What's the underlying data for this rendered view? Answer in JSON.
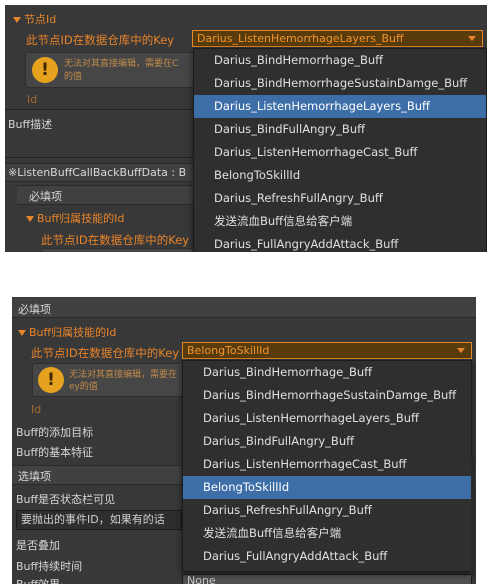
{
  "top": {
    "section_header": "节点Id",
    "key_label": "此节点ID在数据仓库中的Key",
    "selected_value": "Darius_ListenHemorrhageLayers_Buff",
    "help_text_line1": "无法对其直接编辑，需要在C",
    "help_text_line2": "的值",
    "id_label": "Id",
    "buff_desc_label": "Buff描述",
    "buffdata_header": "※ListenBuffCallBackBuffData : B",
    "required_label": "必填项",
    "skill_id_header": "Buff归属技能的Id",
    "key_label2": "此节点ID在数据仓库中的Key"
  },
  "bottom": {
    "required_label": "必填项",
    "skill_id_header": "Buff归属技能的Id",
    "key_label": "此节点ID在数据仓库中的Key",
    "selected_value": "BelongToSkillId",
    "help_text_line1": "无法对其直接编辑，需要在",
    "help_text_line2": "ey的值",
    "id_label": "Id",
    "add_target_label": "Buff的添加目标",
    "basic_feature_label": "Buff的基本特征",
    "optional_label": "选填项",
    "status_bar_label": "Buff是否状态栏可见",
    "event_id_value": "要抛出的事件ID，如果有的话",
    "stackable_label": "是否叠加",
    "duration_label": "Buff持续时间",
    "partial_label": "Buff效果·",
    "none_value": "None"
  },
  "dropdown_options": [
    "Darius_BindHemorrhage_Buff",
    "Darius_BindHemorrhageSustainDamge_Buff",
    "Darius_ListenHemorrhageLayers_Buff",
    "Darius_BindFullAngry_Buff",
    "Darius_ListenHemorrhageCast_Buff",
    "BelongToSkillId",
    "Darius_RefreshFullAngry_Buff",
    "发送流血Buff信息给客户端",
    "Darius_FullAngryAddAttack_Buff"
  ],
  "colors": {
    "panel_bg": "#383838",
    "accent_orange": "#e8842a",
    "selection_blue": "#3d6ea8",
    "warning_yellow": "#e6a11f"
  },
  "icons": {
    "warning": "warning-icon",
    "foldout": "foldout-arrow-icon",
    "caret": "dropdown-caret-icon"
  }
}
